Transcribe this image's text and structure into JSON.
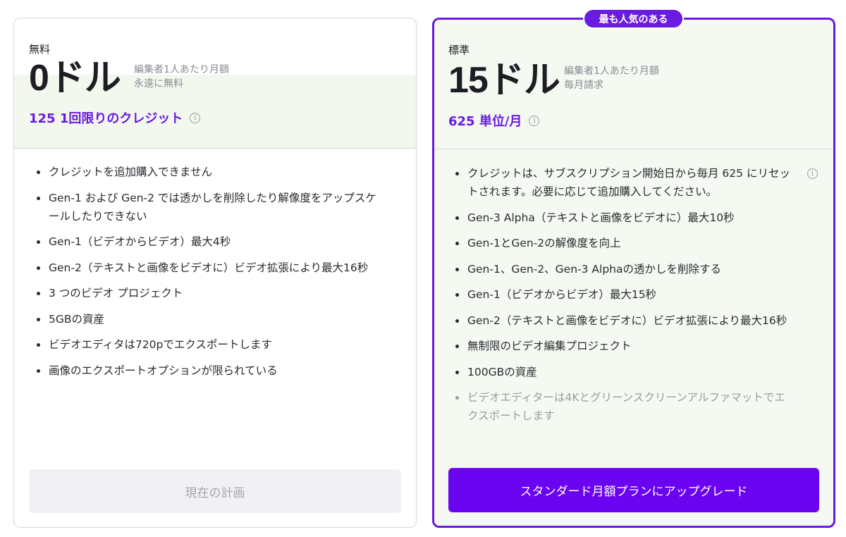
{
  "free_plan": {
    "name": "無料",
    "price": "0ドル",
    "sub_line1": "編集者1人あたり月額",
    "sub_line2": "永遠に無料",
    "credits": "125 1回限りのクレジット",
    "credits_info_icon": "info-icon",
    "features": [
      "クレジットを追加購入できません",
      "Gen-1 および Gen-2 では透かしを削除したり解像度をアップスケールしたりできない",
      "Gen-1（ビデオからビデオ）最大4秒",
      "Gen-2（テキストと画像をビデオに）ビデオ拡張により最大16秒",
      "3 つのビデオ プロジェクト",
      "5GBの資産",
      "ビデオエディタは720pでエクスポートします",
      "画像のエクスポートオプションが限られている"
    ],
    "button_label": "現在の計画"
  },
  "standard_plan": {
    "badge": "最も人気のある",
    "name": "標準",
    "price": "15ドル",
    "sub_line1": "編集者1人あたり月額",
    "sub_line2": "毎月請求",
    "credits": "625 単位/月",
    "credits_info_icon": "info-icon",
    "features": [
      "クレジットは、サブスクリプション開始日から毎月 625 にリセットされます。必要に応じて追加購入してください。",
      "Gen-3 Alpha（テキストと画像をビデオに）最大10秒",
      "Gen-1とGen-2の解像度を向上",
      "Gen-1、Gen-2、Gen-3 Alphaの透かしを削除する",
      "Gen-1（ビデオからビデオ）最大15秒",
      "Gen-2（テキストと画像をビデオに）ビデオ拡張により最大16秒",
      "無制限のビデオ編集プロジェクト",
      "100GBの資産",
      "ビデオエディターは4Kとグリーンスクリーンアルファマットでエクスポートします"
    ],
    "button_label": "スタンダード月額プランにアップグレード"
  },
  "colors": {
    "accent": "#6a1be0",
    "button_primary": "#6a04f0",
    "tint": "#f2f8ee"
  }
}
